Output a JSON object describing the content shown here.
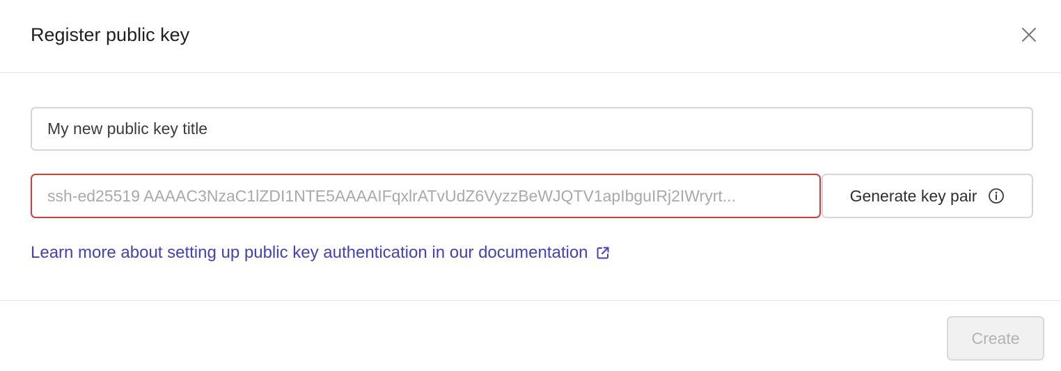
{
  "dialog": {
    "title": "Register public key",
    "close_icon": "close-icon"
  },
  "form": {
    "title_field": {
      "value": "",
      "placeholder": "My new public key title"
    },
    "key_field": {
      "value": "",
      "placeholder": "ssh-ed25519 AAAAC3NzaC1lZDI1NTE5AAAAIFqxlrATvUdZ6VyzzBeWJQTV1apIbguIRj2IWryrt..."
    },
    "generate_button": {
      "label": "Generate key pair",
      "icon": "info-icon"
    },
    "doc_link": {
      "label": "Learn more about setting up public key authentication in our documentation",
      "icon": "external-link-icon"
    }
  },
  "footer": {
    "create_label": "Create"
  },
  "colors": {
    "error_border": "#d63b3b",
    "link": "#4040c8",
    "disabled_bg": "#f1f1f1"
  }
}
